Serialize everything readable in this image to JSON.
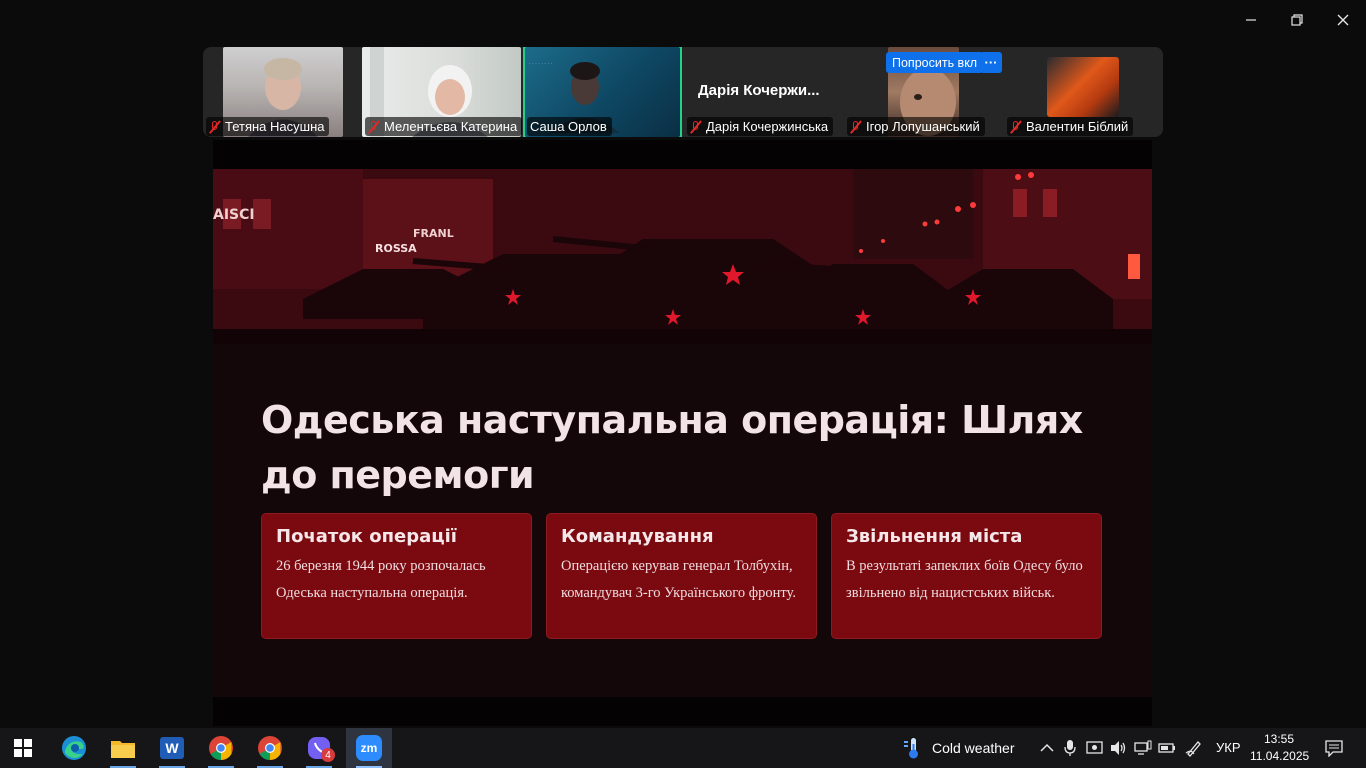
{
  "window": {
    "minimize_icon": "minimize-icon",
    "restore_icon": "restore-icon",
    "close_icon": "close-icon"
  },
  "participants": [
    {
      "name": "Тетяна Насушна",
      "muted": true
    },
    {
      "name": "Мелентьєва Катерина",
      "muted": true
    },
    {
      "name": "Саша Орлов",
      "muted": false,
      "active_speaker": true
    },
    {
      "name": "Дарія Кочержинська",
      "muted": true,
      "display": "Дарія  Кочержи..."
    },
    {
      "name": "Ігор Лопушанський",
      "muted": true
    },
    {
      "name": "Валентин Біблий",
      "muted": true
    }
  ],
  "ask_unmute_label": "Попросить вкл",
  "more_label": "···",
  "slide": {
    "title": "Одеська наступальна операція: Шлях до перемоги",
    "cards": [
      {
        "heading": "Початок операції",
        "text": "26 березня 1944 року розпочалась Одеська наступальна операція."
      },
      {
        "heading": "Командування",
        "text": "Операцією керував генерал Толбухін, командувач 3-го Українського фронту."
      },
      {
        "heading": "Звільнення міста",
        "text": "В результаті запеклих боїв Одесу було звільнено від нацистських військ."
      }
    ],
    "hero_signs": [
      "AISCI",
      "FRANL",
      "ROSSA"
    ]
  },
  "taskbar": {
    "apps": [
      {
        "name": "start",
        "icon": "windows-start-icon"
      },
      {
        "name": "edge",
        "icon": "edge-icon"
      },
      {
        "name": "file-explorer",
        "icon": "folder-icon"
      },
      {
        "name": "word",
        "icon": "word-icon",
        "letter": "W"
      },
      {
        "name": "chrome-1",
        "icon": "chrome-icon"
      },
      {
        "name": "chrome-2",
        "icon": "chrome-icon"
      },
      {
        "name": "viber",
        "icon": "viber-icon",
        "badge": "4"
      },
      {
        "name": "zoom",
        "icon": "zoom-icon",
        "letter": "zm"
      }
    ],
    "weather": "Cold weather",
    "language": "УКР",
    "time": "13:55",
    "date": "11.04.2025"
  }
}
